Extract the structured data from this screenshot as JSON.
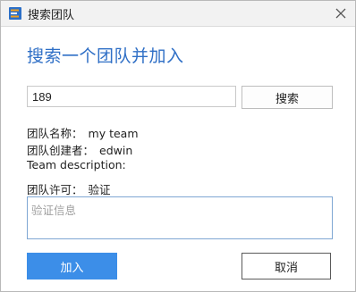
{
  "window": {
    "title": "搜索团队",
    "app_icon": "app-logo-icon",
    "close_icon": "close-icon"
  },
  "heading": "搜索一个团队并加入",
  "search": {
    "value": "189",
    "button_label": "搜索"
  },
  "team": {
    "name_label": "团队名称：",
    "name_value": "my team",
    "creator_label": "团队创建者：",
    "creator_value": "edwin",
    "description_label": "Team description:",
    "permission_label": "团队许可：",
    "permission_value": "验证"
  },
  "verify": {
    "placeholder": "验证信息"
  },
  "actions": {
    "join_label": "加入",
    "cancel_label": "取消"
  },
  "colors": {
    "accent": "#3c8ee8",
    "heading": "#2f6fc6"
  }
}
